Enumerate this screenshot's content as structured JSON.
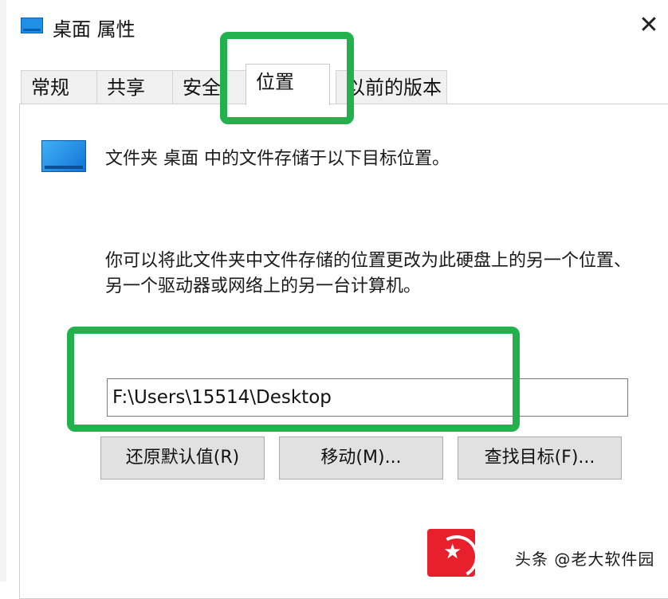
{
  "window": {
    "title": "桌面 属性",
    "close_glyph": "✕"
  },
  "tabs": [
    {
      "label": "常规"
    },
    {
      "label": "共享"
    },
    {
      "label": "安全"
    },
    {
      "label": "位置",
      "active": true
    },
    {
      "label": "以前的版本"
    }
  ],
  "location": {
    "description": "文件夹 桌面 中的文件存储于以下目标位置。",
    "info": "你可以将此文件夹中文件存储的位置更改为此硬盘上的另一个位置、另一个驱动器或网络上的另一台计算机。",
    "path": "F:\\Users\\15514\\Desktop"
  },
  "buttons": {
    "restore": "还原默认值(R)",
    "move": "移动(M)...",
    "find_target": "查找目标(F)..."
  },
  "watermark": {
    "text": "头条 @老大软件园"
  },
  "colors": {
    "highlight": "#22b14c",
    "folder_icon": "#1e90e8",
    "watermark_logo": "#e8202d"
  }
}
